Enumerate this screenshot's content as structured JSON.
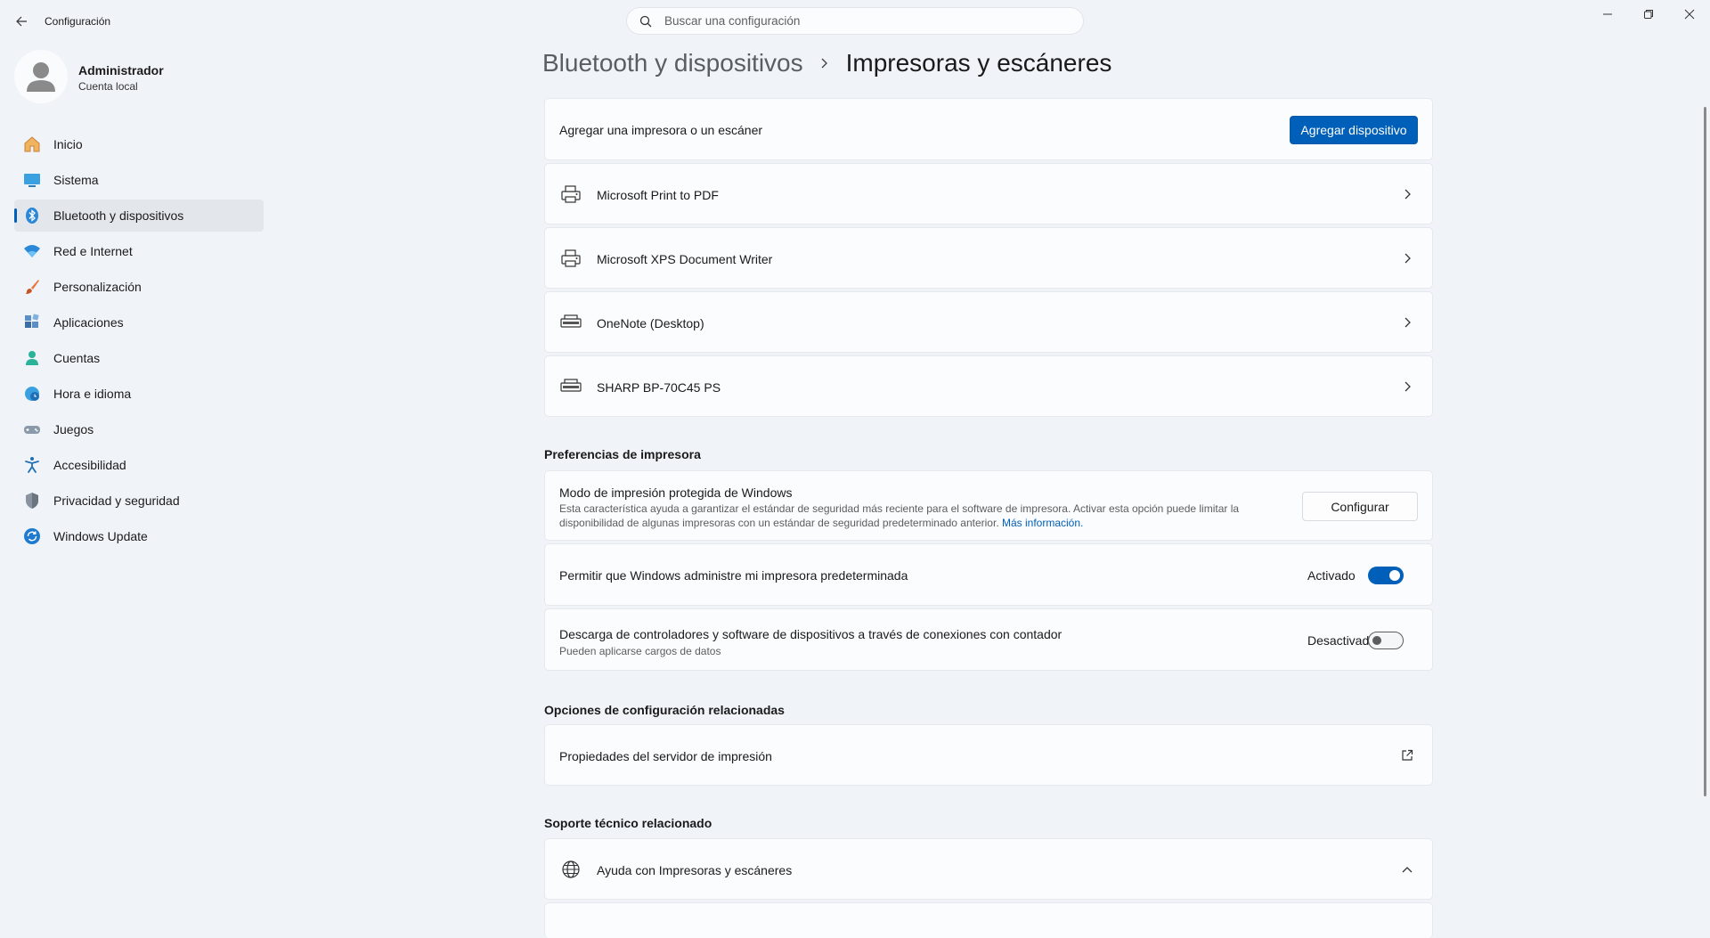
{
  "window": {
    "title": "Configuración"
  },
  "search": {
    "placeholder": "Buscar una configuración"
  },
  "user": {
    "name": "Administrador",
    "account_type": "Cuenta local"
  },
  "sidebar": {
    "items": [
      {
        "label": "Inicio",
        "icon": "home-icon",
        "active": false
      },
      {
        "label": "Sistema",
        "icon": "system-icon",
        "active": false
      },
      {
        "label": "Bluetooth y dispositivos",
        "icon": "bluetooth-icon",
        "active": true
      },
      {
        "label": "Red e Internet",
        "icon": "wifi-icon",
        "active": false
      },
      {
        "label": "Personalización",
        "icon": "brush-icon",
        "active": false
      },
      {
        "label": "Aplicaciones",
        "icon": "apps-icon",
        "active": false
      },
      {
        "label": "Cuentas",
        "icon": "person-icon",
        "active": false
      },
      {
        "label": "Hora e idioma",
        "icon": "globe-clock-icon",
        "active": false
      },
      {
        "label": "Juegos",
        "icon": "gamepad-icon",
        "active": false
      },
      {
        "label": "Accesibilidad",
        "icon": "accessibility-icon",
        "active": false
      },
      {
        "label": "Privacidad y seguridad",
        "icon": "shield-icon",
        "active": false
      },
      {
        "label": "Windows Update",
        "icon": "update-icon",
        "active": false
      }
    ]
  },
  "breadcrumb": {
    "parent": "Bluetooth y dispositivos",
    "current": "Impresoras y escáneres"
  },
  "add_device": {
    "label": "Agregar una impresora o un escáner",
    "button": "Agregar dispositivo"
  },
  "printers": [
    {
      "name": "Microsoft Print to PDF",
      "icon": "virtual-printer-icon"
    },
    {
      "name": "Microsoft XPS Document Writer",
      "icon": "virtual-printer-icon"
    },
    {
      "name": "OneNote (Desktop)",
      "icon": "printer-icon"
    },
    {
      "name": "SHARP BP-70C45 PS",
      "icon": "printer-icon"
    }
  ],
  "printer_preferences": {
    "heading": "Preferencias de impresora",
    "protected_mode": {
      "title": "Modo de impresión protegida de Windows",
      "description_line1": "Esta característica ayuda a garantizar el estándar de seguridad más reciente para el software de impresora. Activar esta opción puede limitar la",
      "description_line2": "disponibilidad de algunas impresoras con un estándar de seguridad predeterminado anterior.",
      "link": "Más información.",
      "button": "Configurar"
    },
    "manage_default": {
      "title": "Permitir que Windows administre mi impresora predeterminada",
      "state": "Activado",
      "on": true
    },
    "metered_download": {
      "title": "Descarga de controladores y software de dispositivos a través de conexiones con contador",
      "subtitle": "Pueden aplicarse cargos de datos",
      "state": "Desactivado",
      "on": false
    }
  },
  "related_settings": {
    "heading": "Opciones de configuración relacionadas",
    "items": [
      {
        "label": "Propiedades del servidor de impresión"
      }
    ]
  },
  "related_support": {
    "heading": "Soporte técnico relacionado",
    "items": [
      {
        "label": "Ayuda con Impresoras y escáneres"
      }
    ]
  },
  "colors": {
    "accent": "#005fb8",
    "background": "#f0f4f9",
    "card": "#fbfcfd"
  }
}
